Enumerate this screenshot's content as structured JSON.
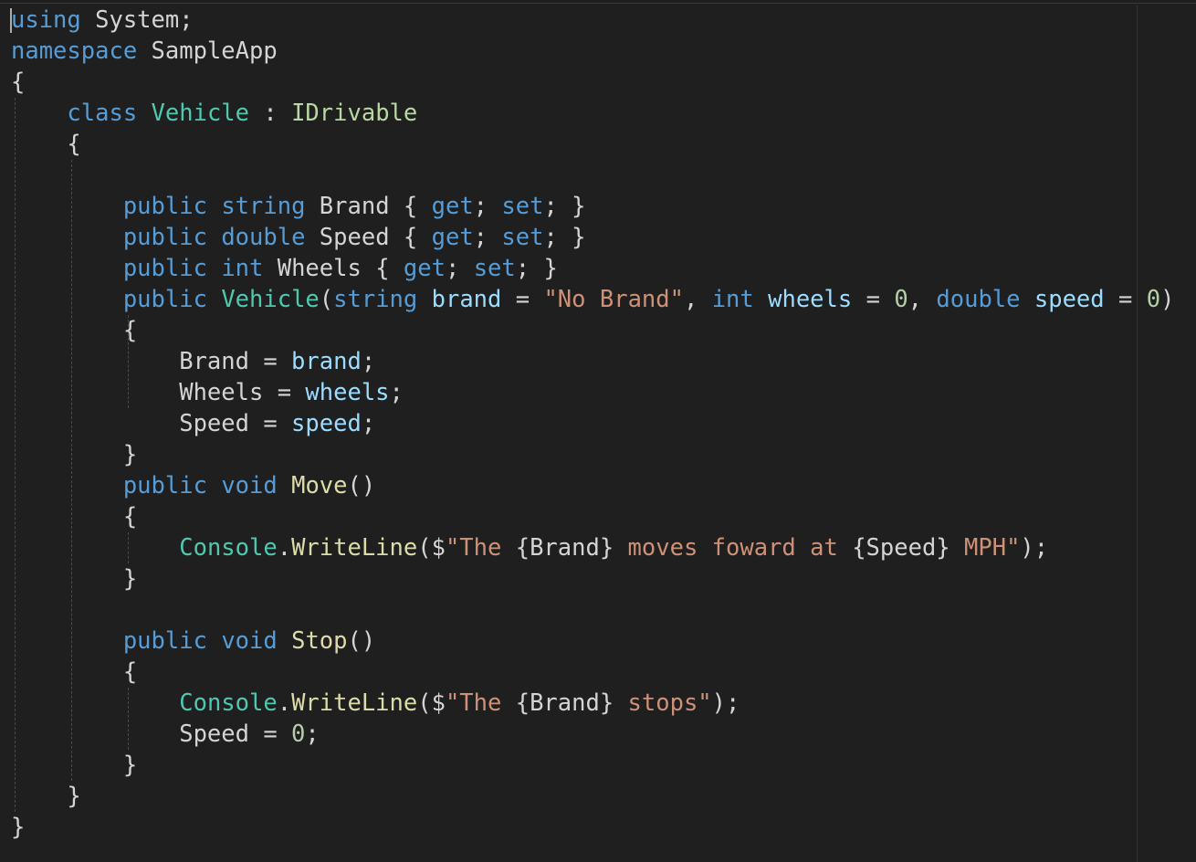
{
  "editor": {
    "language": "csharp",
    "colors": {
      "background": "#1f1f1f",
      "keyword": "#569cd6",
      "type": "#4ec9b0",
      "interface": "#b8d7a3",
      "string": "#ce9178",
      "parameter": "#9cdcfe",
      "method": "#dcdcaa",
      "number": "#b5cea8",
      "plain": "#d4d4d4"
    },
    "lines": [
      [
        [
          "kw",
          "using"
        ],
        [
          "pl",
          " System;"
        ]
      ],
      [
        [
          "kw",
          "namespace"
        ],
        [
          "pl",
          " SampleApp"
        ]
      ],
      [
        [
          "pl",
          "{"
        ]
      ],
      [
        [
          "pl",
          "    "
        ],
        [
          "kw",
          "class"
        ],
        [
          "pl",
          " "
        ],
        [
          "ty",
          "Vehicle"
        ],
        [
          "pl",
          " : "
        ],
        [
          "if",
          "IDrivable"
        ]
      ],
      [
        [
          "pl",
          "    {"
        ]
      ],
      [],
      [
        [
          "pl",
          "        "
        ],
        [
          "kw",
          "public"
        ],
        [
          "pl",
          " "
        ],
        [
          "kw",
          "string"
        ],
        [
          "pl",
          " Brand { "
        ],
        [
          "kw",
          "get"
        ],
        [
          "pl",
          "; "
        ],
        [
          "kw",
          "set"
        ],
        [
          "pl",
          "; }"
        ]
      ],
      [
        [
          "pl",
          "        "
        ],
        [
          "kw",
          "public"
        ],
        [
          "pl",
          " "
        ],
        [
          "kw",
          "double"
        ],
        [
          "pl",
          " Speed { "
        ],
        [
          "kw",
          "get"
        ],
        [
          "pl",
          "; "
        ],
        [
          "kw",
          "set"
        ],
        [
          "pl",
          "; }"
        ]
      ],
      [
        [
          "pl",
          "        "
        ],
        [
          "kw",
          "public"
        ],
        [
          "pl",
          " "
        ],
        [
          "kw",
          "int"
        ],
        [
          "pl",
          " Wheels { "
        ],
        [
          "kw",
          "get"
        ],
        [
          "pl",
          "; "
        ],
        [
          "kw",
          "set"
        ],
        [
          "pl",
          "; }"
        ]
      ],
      [
        [
          "pl",
          "        "
        ],
        [
          "kw",
          "public"
        ],
        [
          "pl",
          " "
        ],
        [
          "ty",
          "Vehicle"
        ],
        [
          "pl",
          "("
        ],
        [
          "kw",
          "string"
        ],
        [
          "pl",
          " "
        ],
        [
          "pa",
          "brand"
        ],
        [
          "pl",
          " = "
        ],
        [
          "st",
          "\"No Brand\""
        ],
        [
          "pl",
          ", "
        ],
        [
          "kw",
          "int"
        ],
        [
          "pl",
          " "
        ],
        [
          "pa",
          "wheels"
        ],
        [
          "pl",
          " = "
        ],
        [
          "nu",
          "0"
        ],
        [
          "pl",
          ", "
        ],
        [
          "kw",
          "double"
        ],
        [
          "pl",
          " "
        ],
        [
          "pa",
          "speed"
        ],
        [
          "pl",
          " = "
        ],
        [
          "nu",
          "0"
        ],
        [
          "pl",
          ")"
        ]
      ],
      [
        [
          "pl",
          "        {"
        ]
      ],
      [
        [
          "pl",
          "            Brand = "
        ],
        [
          "pa",
          "brand"
        ],
        [
          "pl",
          ";"
        ]
      ],
      [
        [
          "pl",
          "            Wheels = "
        ],
        [
          "pa",
          "wheels"
        ],
        [
          "pl",
          ";"
        ]
      ],
      [
        [
          "pl",
          "            Speed = "
        ],
        [
          "pa",
          "speed"
        ],
        [
          "pl",
          ";"
        ]
      ],
      [
        [
          "pl",
          "        }"
        ]
      ],
      [
        [
          "pl",
          "        "
        ],
        [
          "kw",
          "public"
        ],
        [
          "pl",
          " "
        ],
        [
          "kw",
          "void"
        ],
        [
          "pl",
          " "
        ],
        [
          "fn",
          "Move"
        ],
        [
          "pl",
          "()"
        ]
      ],
      [
        [
          "pl",
          "        {"
        ]
      ],
      [
        [
          "pl",
          "            "
        ],
        [
          "ty",
          "Console"
        ],
        [
          "pl",
          "."
        ],
        [
          "fn",
          "WriteLine"
        ],
        [
          "pl",
          "($"
        ],
        [
          "st",
          "\"The "
        ],
        [
          "pl",
          "{Brand}"
        ],
        [
          "st",
          " moves foward at "
        ],
        [
          "pl",
          "{Speed}"
        ],
        [
          "st",
          " MPH\""
        ],
        [
          "pl",
          ");"
        ]
      ],
      [
        [
          "pl",
          "        }"
        ]
      ],
      [],
      [
        [
          "pl",
          "        "
        ],
        [
          "kw",
          "public"
        ],
        [
          "pl",
          " "
        ],
        [
          "kw",
          "void"
        ],
        [
          "pl",
          " "
        ],
        [
          "fn",
          "Stop"
        ],
        [
          "pl",
          "()"
        ]
      ],
      [
        [
          "pl",
          "        {"
        ]
      ],
      [
        [
          "pl",
          "            "
        ],
        [
          "ty",
          "Console"
        ],
        [
          "pl",
          "."
        ],
        [
          "fn",
          "WriteLine"
        ],
        [
          "pl",
          "($"
        ],
        [
          "st",
          "\"The "
        ],
        [
          "pl",
          "{Brand}"
        ],
        [
          "st",
          " stops\""
        ],
        [
          "pl",
          ");"
        ]
      ],
      [
        [
          "pl",
          "            Speed = "
        ],
        [
          "nu",
          "0"
        ],
        [
          "pl",
          ";"
        ]
      ],
      [
        [
          "pl",
          "        }"
        ]
      ],
      [
        [
          "pl",
          "    }"
        ]
      ],
      [
        [
          "pl",
          "}"
        ]
      ]
    ]
  }
}
